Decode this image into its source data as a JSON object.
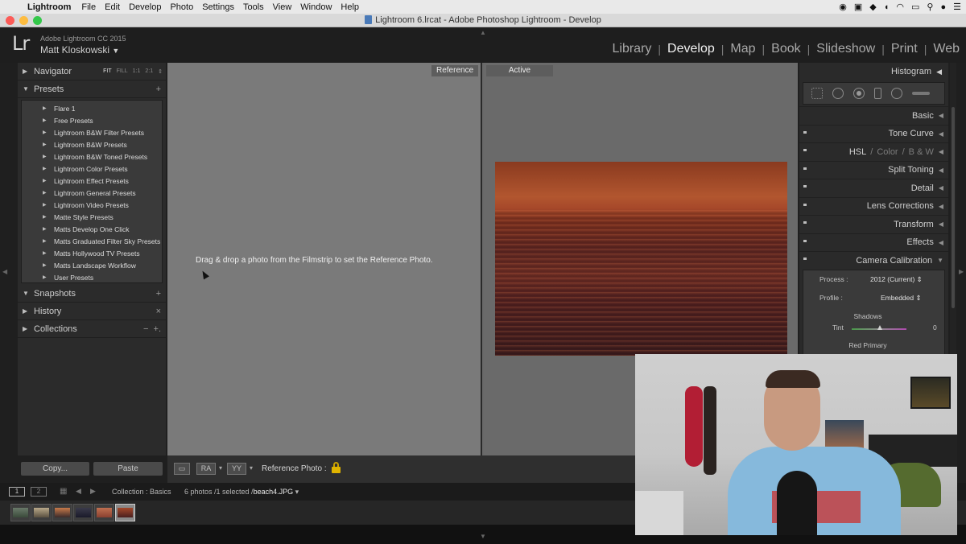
{
  "menubar": {
    "app": "Lightroom",
    "items": [
      "File",
      "Edit",
      "Develop",
      "Photo",
      "Settings",
      "Tools",
      "View",
      "Window",
      "Help"
    ]
  },
  "window": {
    "title": "Lightroom 6.lrcat - Adobe Photoshop Lightroom - Develop"
  },
  "identity": {
    "logo": "Lr",
    "product": "Adobe Lightroom CC 2015",
    "user": "Matt Kloskowski",
    "user_arrow": "▼"
  },
  "modules": [
    "Library",
    "Develop",
    "Map",
    "Book",
    "Slideshow",
    "Print",
    "Web"
  ],
  "active_module": "Develop",
  "left_panel": {
    "navigator": {
      "label": "Navigator",
      "options": [
        "FIT",
        "FILL",
        "1:1",
        "2:1"
      ]
    },
    "presets": {
      "label": "Presets",
      "add": "+",
      "items": [
        "Flare 1",
        "Free Presets",
        "Lightroom B&W Filter Presets",
        "Lightroom B&W Presets",
        "Lightroom B&W Toned Presets",
        "Lightroom Color Presets",
        "Lightroom Effect Presets",
        "Lightroom General Presets",
        "Lightroom Video Presets",
        "Matte Style Presets",
        "Matts Develop One Click",
        "Matts Graduated Filter Sky Presets",
        "Matts Hollywood TV Presets",
        "Matts Landscape Workflow",
        "User Presets"
      ]
    },
    "snapshots": {
      "label": "Snapshots",
      "add": "+"
    },
    "history": {
      "label": "History",
      "clear": "×"
    },
    "collections": {
      "label": "Collections",
      "minus": "−",
      "plus": "+."
    },
    "copy_label": "Copy...",
    "paste_label": "Paste"
  },
  "center": {
    "reference_tag": "Reference",
    "active_tag": "Active",
    "reference_hint": "Drag & drop a photo from the Filmstrip to set the Reference Photo."
  },
  "toolbar": {
    "reference_photo_label": "Reference Photo :",
    "ra_label": "RA",
    "yy_label": "YY"
  },
  "right_panel": {
    "histogram": "Histogram",
    "sections": [
      "Basic",
      "Tone Curve",
      "Split Toning",
      "Detail",
      "Lens Corrections",
      "Transform",
      "Effects",
      "Camera Calibration"
    ],
    "hsl": {
      "hsl": "HSL",
      "color": "Color",
      "bw": "B & W",
      "sep": "/"
    },
    "calibration": {
      "process_label": "Process :",
      "process_value": "2012 (Current)",
      "profile_label": "Profile :",
      "profile_value": "Embedded",
      "shadows": "Shadows",
      "tint_label": "Tint",
      "tint_value": "0",
      "red_primary": "Red Primary"
    }
  },
  "filmstrip_bar": {
    "page1": "1",
    "page2": "2",
    "source": "Collection : Basics",
    "count": "6 photos /1 selected /",
    "filename": "beach4.JPG",
    "filename_arrow": "▾"
  },
  "colors": {
    "accent": "#e0b400",
    "panel": "#2b2b2b",
    "background": "#1f1f1f"
  }
}
